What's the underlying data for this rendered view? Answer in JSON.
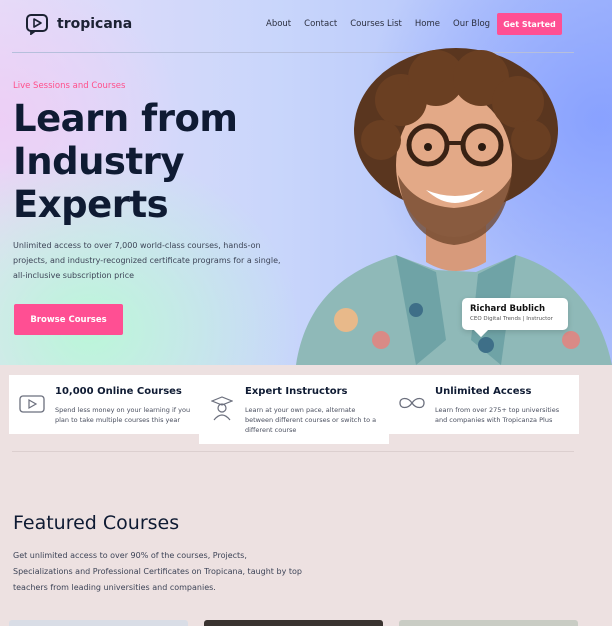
{
  "brand": {
    "name": "tropicana",
    "accent": "#ff4f93"
  },
  "nav": {
    "items": [
      "About",
      "Contact",
      "Courses List",
      "Home",
      "Our Blog"
    ],
    "cta": "Get Started"
  },
  "hero": {
    "eyebrow": "Live Sessions and Courses",
    "headline": "Learn from Industry Experts",
    "lead": "Unlimited access to over 7,000 world-class courses, hands-on projects, and industry-recognized certificate programs for a single, all-inclusive subscription price",
    "cta": "Browse Courses",
    "instructor": {
      "name": "Richard Bublich",
      "role": "CEO Digital Trends | Instructor"
    }
  },
  "features": [
    {
      "icon": "video-play-icon",
      "title": "10,000 Online Courses",
      "text": "Spend less money on your learning if you plan to take multiple courses this year"
    },
    {
      "icon": "graduate-icon",
      "title": "Expert Instructors",
      "text": "Learn at your own pace, alternate between different courses or switch to a different course"
    },
    {
      "icon": "infinity-icon",
      "title": "Unlimited Access",
      "text": "Learn from over 275+ top universities and companies with Tropicanza Plus"
    }
  ],
  "featured": {
    "title": "Featured Courses",
    "text": "Get unlimited access to over 90% of the courses, Projects, Specializations and Professional Certificates on Tropicana, taught by top teachers from leading universities and companies."
  }
}
